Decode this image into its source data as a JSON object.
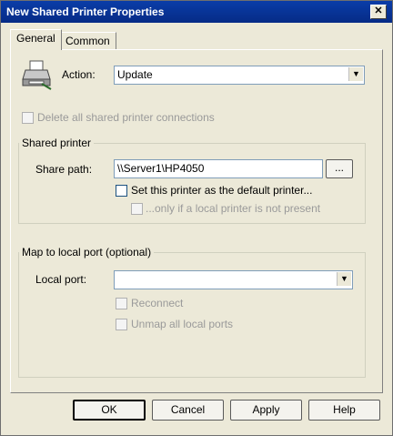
{
  "window": {
    "title": "New Shared Printer Properties",
    "close_glyph": "✕"
  },
  "tabs": [
    {
      "label": "General",
      "active": true
    },
    {
      "label": "Common",
      "active": false
    }
  ],
  "action": {
    "label": "Action:",
    "value": "Update"
  },
  "delete_all": {
    "label": "Delete all shared printer connections",
    "checked": false,
    "enabled": false
  },
  "shared_printer": {
    "group_title": "Shared printer",
    "share_path_label": "Share path:",
    "share_path_value": "\\\\Server1\\HP4050",
    "browse_label": "...",
    "default_printer_label": "Set this printer as the default printer...",
    "only_if_label": "...only if a local printer is not present"
  },
  "map_port": {
    "group_title": "Map to local port (optional)",
    "local_port_label": "Local port:",
    "local_port_value": "",
    "reconnect_label": "Reconnect",
    "unmap_label": "Unmap all local ports"
  },
  "buttons": {
    "ok": "OK",
    "cancel": "Cancel",
    "apply": "Apply",
    "help": "Help"
  }
}
